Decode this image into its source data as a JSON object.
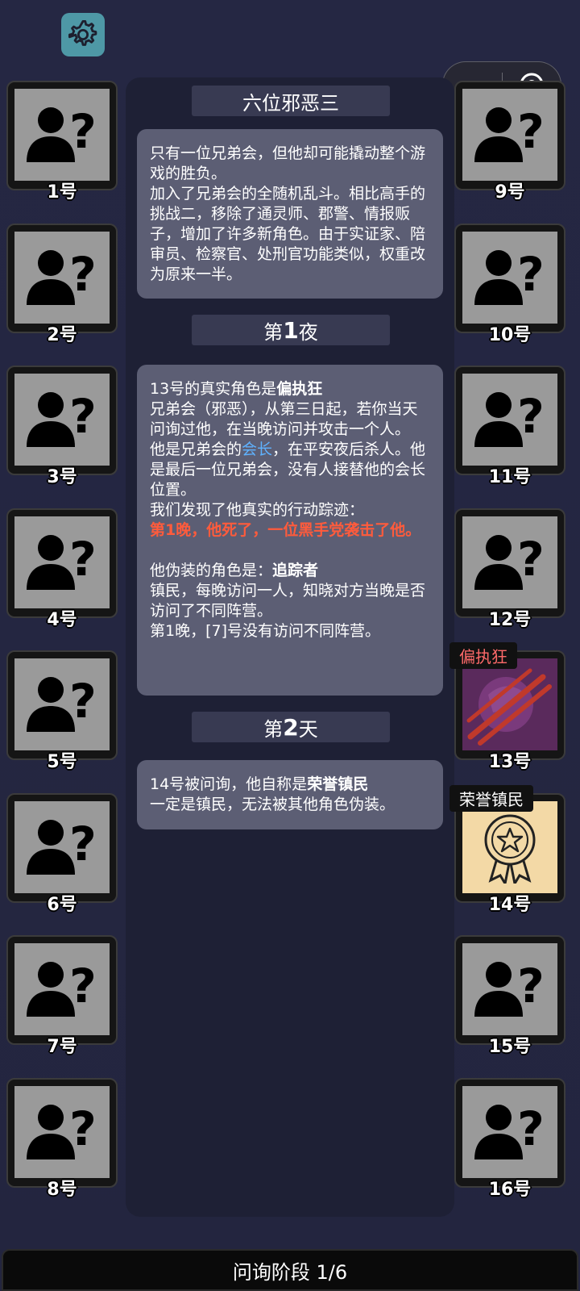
{
  "header": {
    "settings_icon": "gear-icon",
    "capsule": {
      "more_icon": "more-dots-icon",
      "close_icon": "record-circle-icon"
    }
  },
  "left_slots": [
    "1号",
    "2号",
    "3号",
    "4号",
    "5号",
    "6号",
    "7号",
    "8号"
  ],
  "right_slots": [
    "9号",
    "10号",
    "11号",
    "12号",
    "13号",
    "14号",
    "15号",
    "16号"
  ],
  "revealed": {
    "slot13": {
      "role": "偏执狂",
      "icon": "claw-slash-icon",
      "color": "#5a2a5c"
    },
    "slot14": {
      "role": "荣誉镇民",
      "icon": "medal-icon",
      "color": "#f3d9a6"
    }
  },
  "log": {
    "scenario_title": "六位邪恶三",
    "intro": {
      "line1": "只有一位兄弟会，但他却可能撬动整个游戏的胜负。",
      "line2": "加入了兄弟会的全随机乱斗。相比高手的挑战二，移除了通灵师、郡警、情报贩子，增加了许多新角色。由于实证家、陪审员、检察官、处刑官功能类似，权重改为原来一半。"
    },
    "night1": {
      "heading_prefix": "第",
      "heading_num": "1",
      "heading_suffix": "夜",
      "reveal_prefix": "13号的真实角色是",
      "reveal_role": "偏执狂",
      "role_desc": "兄弟会（邪恶），从第三日起，若你当天问询过他，在当晚访问并攻击一个人。",
      "leader_a": "他是兄弟会的",
      "leader_link": "会长",
      "leader_b": "，在平安夜后杀人。他是最后一位兄弟会，没有人接替他的会长位置。",
      "trace_label": "我们发现了他真实的行动踪迹：",
      "trace_event": "第1晚，他死了，一位黑手党袭击了他。",
      "disguise_prefix": "他伪装的角色是：",
      "disguise_role": "追踪者",
      "disguise_desc": "镇民，每晚访问一人，知晓对方当晚是否访问了不同阵营。",
      "disguise_result": "第1晚，[7]号没有访问不同阵营。"
    },
    "day2": {
      "heading_prefix": "第",
      "heading_num": "2",
      "heading_suffix": "天",
      "claim_prefix": "14号被问询，他自称是",
      "claim_role": "荣誉镇民",
      "claim_desc": "一定是镇民，无法被其他角色伪装。"
    }
  },
  "phase_bar": "问询阶段 1/6"
}
